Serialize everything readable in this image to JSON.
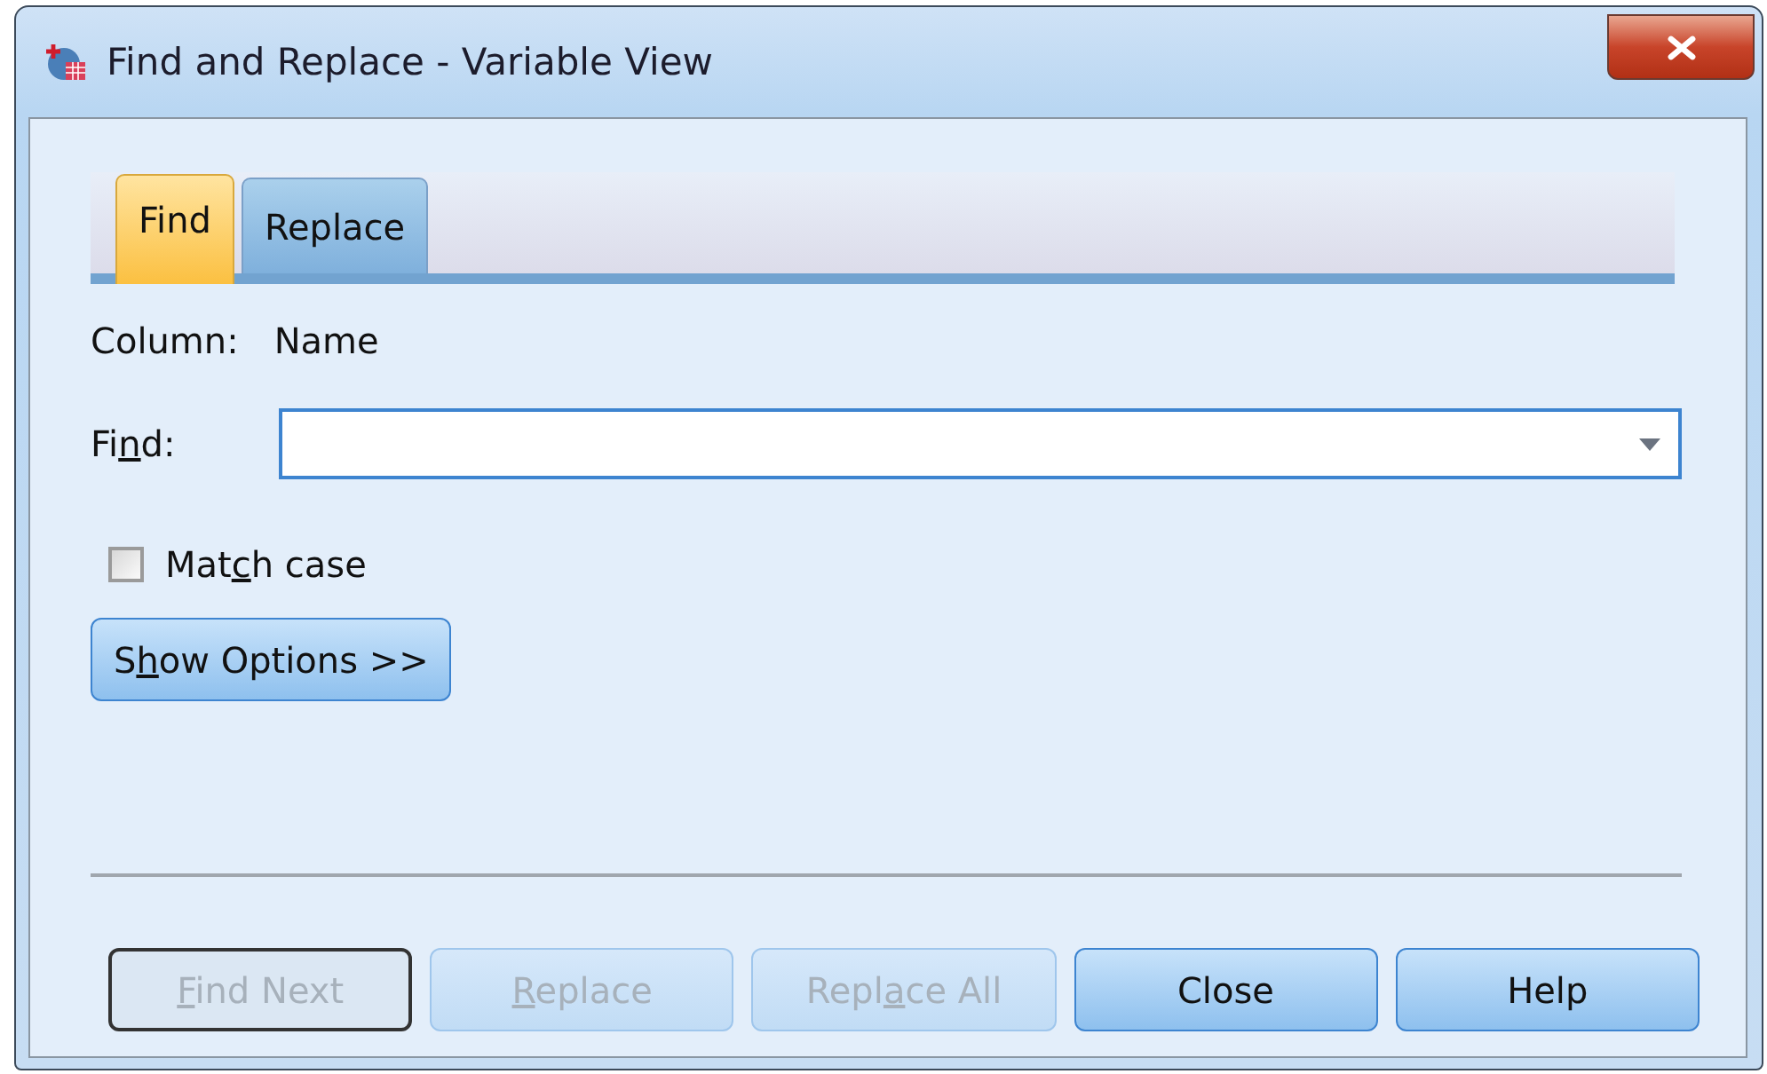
{
  "window": {
    "title": "Find and Replace - Variable View"
  },
  "tabs": [
    {
      "label": "Find",
      "selected": true
    },
    {
      "label": "Replace",
      "selected": false
    }
  ],
  "column": {
    "label": "Column:",
    "value": "Name"
  },
  "find": {
    "label": {
      "before": "Fi",
      "key": "n",
      "after": "d:"
    }
  },
  "match_case": {
    "label": {
      "before": "Mat",
      "key": "c",
      "after": "h case"
    },
    "checked": false
  },
  "show_options": {
    "label": {
      "before": "S",
      "key": "h",
      "after": "ow Options >>"
    }
  },
  "buttons": [
    {
      "label": {
        "key": "F",
        "after": "ind Next"
      },
      "disabled": true,
      "focused": true
    },
    {
      "label": {
        "key": "R",
        "after": "eplace"
      },
      "disabled": true,
      "focused": false
    },
    {
      "label": {
        "before": "Repl",
        "key": "a",
        "after": "ce All"
      },
      "disabled": true,
      "focused": false
    },
    {
      "label": {
        "before": "Close"
      },
      "disabled": false,
      "focused": false
    },
    {
      "label": {
        "before": "Help"
      },
      "disabled": false,
      "focused": false
    }
  ]
}
